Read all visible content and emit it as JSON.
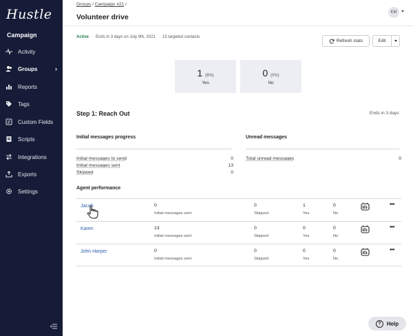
{
  "app": {
    "logo": "Hustle",
    "section": "Campaign"
  },
  "sidebar": {
    "items": [
      {
        "label": "Activity",
        "icon": "activity-icon",
        "active": false
      },
      {
        "label": "Groups",
        "icon": "groups-icon",
        "active": true
      },
      {
        "label": "Reports",
        "icon": "reports-icon",
        "active": false
      },
      {
        "label": "Tags",
        "icon": "tag-icon",
        "active": false
      },
      {
        "label": "Custom Fields",
        "icon": "custom-fields-icon",
        "active": false
      },
      {
        "label": "Scripts",
        "icon": "scripts-icon",
        "active": false
      },
      {
        "label": "Integrations",
        "icon": "integrations-icon",
        "active": false
      },
      {
        "label": "Exports",
        "icon": "exports-icon",
        "active": false
      },
      {
        "label": "Settings",
        "icon": "gear-icon",
        "active": false
      }
    ]
  },
  "breadcrumb": {
    "groups": "Groups",
    "sep1": "/",
    "campaign": "Campaign #21",
    "sep2": "/"
  },
  "header": {
    "title": "Volunteer drive",
    "avatar_initials": "KM"
  },
  "status": {
    "state": "Active",
    "ends": "Ends in 3 days on July 9th, 2021",
    "contacts": "13 targeted contacts",
    "sep": "·"
  },
  "actions": {
    "refresh": "Refresh stats",
    "edit": "Edit"
  },
  "stats": [
    {
      "value": "1",
      "pct": "(8%)",
      "label": "Yes"
    },
    {
      "value": "0",
      "pct": "(0%)",
      "label": "No"
    }
  ],
  "step": {
    "title": "Step 1: Reach Out",
    "ends": "Ends in 3 days"
  },
  "progress": {
    "title": "Initial messages progress",
    "rows": [
      {
        "label": "Initial messages to send",
        "value": "0"
      },
      {
        "label": "Initial messages sent",
        "value": "13"
      },
      {
        "label": "Skipped",
        "value": "0"
      }
    ]
  },
  "unread": {
    "title": "Unread messages",
    "rows": [
      {
        "label": "Total unread messages",
        "value": "0"
      }
    ]
  },
  "agents": {
    "title": "Agent performance",
    "sent_label": "Initial messages sent",
    "skipped_label": "Skipped",
    "yes_label": "Yes",
    "no_label": "No",
    "more": "•••",
    "rows": [
      {
        "name": "Jacob",
        "sent": "0",
        "skipped": "0",
        "yes": "1",
        "no": "0"
      },
      {
        "name": "Karen",
        "sent": "13",
        "skipped": "0",
        "yes": "0",
        "no": "0"
      },
      {
        "name": "John Harper",
        "sent": "0",
        "skipped": "0",
        "yes": "0",
        "no": "0"
      }
    ]
  },
  "help": {
    "label": "Help",
    "icon_glyph": "?"
  },
  "colors": {
    "sidebar": "#161b37",
    "active_status": "#1f7a4a",
    "link": "#2a5db0",
    "stat_box": "#eceef3"
  }
}
